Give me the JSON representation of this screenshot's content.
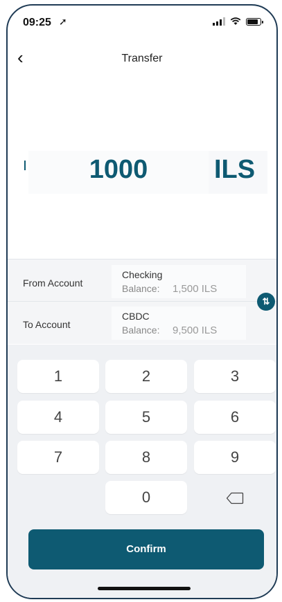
{
  "status_bar": {
    "time": "09:25"
  },
  "header": {
    "title": "Transfer"
  },
  "amount": {
    "value": "1000",
    "currency": "ILS"
  },
  "from_account": {
    "label": "From Account",
    "name": "Checking",
    "balance_label": "Balance:",
    "balance": "1,500 ILS"
  },
  "to_account": {
    "label": "To Account",
    "name": "CBDC",
    "balance_label": "Balance:",
    "balance": "9,500 ILS"
  },
  "keypad": {
    "k1": "1",
    "k2": "2",
    "k3": "3",
    "k4": "4",
    "k5": "5",
    "k6": "6",
    "k7": "7",
    "k8": "8",
    "k9": "9",
    "k0": "0"
  },
  "confirm_label": "Confirm",
  "colors": {
    "accent": "#0e5a72",
    "frame": "#1f3b55"
  }
}
